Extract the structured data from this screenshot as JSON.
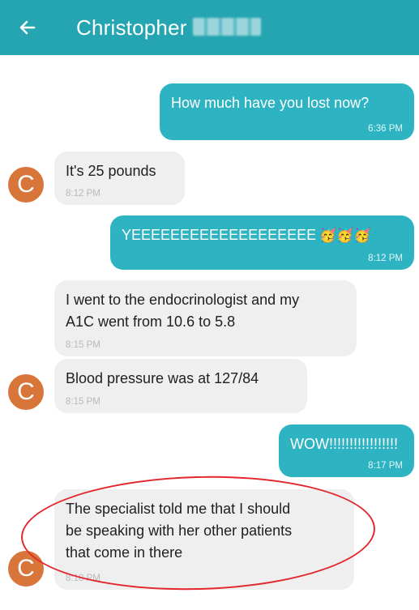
{
  "header": {
    "back_icon": "arrow-left-icon",
    "title": "Christopher"
  },
  "colors": {
    "header": "#24a5b1",
    "outgoing": "#2db3c2",
    "incoming": "#efefef",
    "avatar": "#d8753a",
    "annotation": "#e3262b"
  },
  "avatar_initial": "C",
  "messages": [
    {
      "direction": "outgoing",
      "text": "How much have you lost now?",
      "time": "6:36 PM"
    },
    {
      "direction": "incoming",
      "text": "It's 25 pounds",
      "time": "8:12 PM"
    },
    {
      "direction": "outgoing",
      "text": "YEEEEEEEEEEEEEEEEEEE",
      "emoji": "🥳🥳🥳",
      "time": "8:12 PM"
    },
    {
      "direction": "incoming",
      "lines": [
        "I went to the endocrinologist and my",
        "A1C went from 10.6 to 5.8"
      ],
      "time": "8:15 PM"
    },
    {
      "direction": "incoming",
      "text": "Blood pressure was at 127/84",
      "time": "8:15 PM"
    },
    {
      "direction": "outgoing",
      "text": "WOW!!!!!!!!!!!!!!!!!",
      "time": "8:17 PM"
    },
    {
      "direction": "incoming",
      "lines": [
        "The specialist told me that I should",
        "be speaking with her other patients",
        "that come in there"
      ],
      "time": "8:18 PM"
    }
  ]
}
